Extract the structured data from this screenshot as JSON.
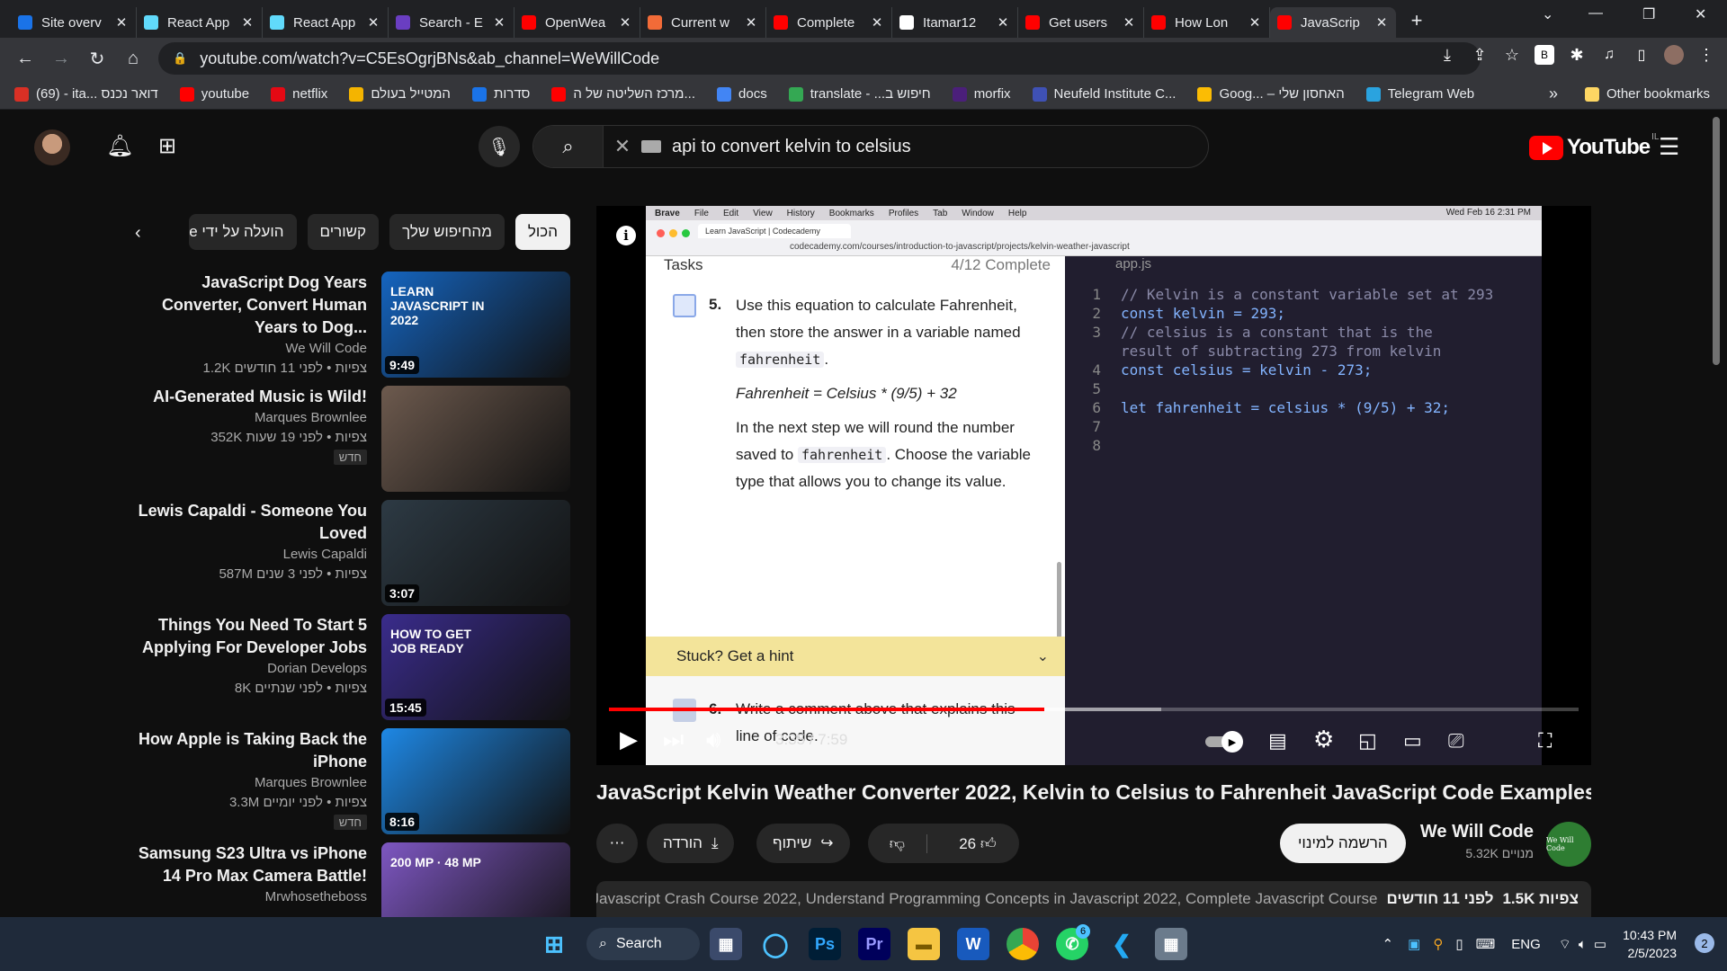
{
  "browser": {
    "tabs": [
      {
        "label": "Site overv",
        "color": "#1a73e8",
        "icon": "site-icon"
      },
      {
        "label": "React App",
        "color": "#61dafb",
        "icon": "react-icon"
      },
      {
        "label": "React App",
        "color": "#61dafb",
        "icon": "react-icon"
      },
      {
        "label": "Search - E",
        "color": "#6a3ec2",
        "icon": "bootstrap-icon"
      },
      {
        "label": "OpenWea",
        "color": "#ff0000",
        "icon": "youtube-icon"
      },
      {
        "label": "Current w",
        "color": "#f26b38",
        "icon": "weather-icon"
      },
      {
        "label": "Complete",
        "color": "#ff0000",
        "icon": "youtube-icon"
      },
      {
        "label": "Itamar12",
        "color": "#ffffff",
        "icon": "github-icon"
      },
      {
        "label": "Get users",
        "color": "#ff0000",
        "icon": "youtube-icon"
      },
      {
        "label": "How Lon",
        "color": "#ff0000",
        "icon": "youtube-icon"
      },
      {
        "label": "JavaScrip",
        "color": "#ff0000",
        "icon": "youtube-icon"
      }
    ],
    "url": "youtube.com/watch?v=C5EsOgrjBNs&ab_channel=WeWillCode",
    "bookmarks": [
      {
        "label": "(69) - ita... דואר נכנס",
        "color": "#d93025"
      },
      {
        "label": "youtube",
        "color": "#ff0000"
      },
      {
        "label": "netflix",
        "color": "#e50914"
      },
      {
        "label": "המטייל בעולם",
        "color": "#f4b400"
      },
      {
        "label": "סדרות",
        "color": "#1a73e8"
      },
      {
        "label": "מרכז השליטה של ה...",
        "color": "#ff0000"
      },
      {
        "label": "docs",
        "color": "#4285f4"
      },
      {
        "label": "translate - ...חיפוש ב",
        "color": "#34a853"
      },
      {
        "label": "morfix",
        "color": "#4b1f7a"
      },
      {
        "label": "Neufeld Institute C...",
        "color": "#3f51b5"
      },
      {
        "label": "Goog... – האחסון שלי",
        "color": "#fbbc04"
      },
      {
        "label": "Telegram Web",
        "color": "#2aa3df"
      }
    ],
    "other_bookmarks": "Other bookmarks"
  },
  "youtube": {
    "search_query": "api to convert kelvin to celsius",
    "logo_text": "YouTube",
    "country_code": "IL",
    "chips": [
      "הכול",
      "מהחיפוש שלך",
      "קשורים",
      "הועלה על ידי We Will Code"
    ],
    "sidebar": [
      {
        "title": "JavaScript Dog Years Converter, Convert Human Years to Dog...",
        "channel": "We Will Code",
        "meta": "1.2K צפיות • לפני 11 חודשים",
        "duration": "9:49",
        "new": "",
        "thumb_bg": "#1565c0",
        "thumb_label": "LEARN JAVASCRIPT IN 2022"
      },
      {
        "title": "AI-Generated Music is Wild!",
        "channel": "Marques Brownlee",
        "meta": "352K צפיות • לפני 19 שעות",
        "duration": "",
        "new": "חדש",
        "thumb_bg": "#6d5a4e",
        "thumb_label": ""
      },
      {
        "title": "Lewis Capaldi - Someone You Loved",
        "channel": "Lewis Capaldi",
        "meta": "587M צפיות • לפני 3 שנים",
        "duration": "3:07",
        "new": "",
        "thumb_bg": "#2d3a44",
        "thumb_label": ""
      },
      {
        "title": "Things You Need To Start 5 Applying For Developer Jobs",
        "channel": "Dorian Develops",
        "meta": "8K צפיות • לפני שנתיים",
        "duration": "15:45",
        "new": "",
        "thumb_bg": "#3a2c8c",
        "thumb_label": "HOW TO GET JOB READY"
      },
      {
        "title": "How Apple is Taking Back the iPhone",
        "channel": "Marques Brownlee",
        "meta": "3.3M צפיות • לפני יומיים",
        "duration": "8:16",
        "new": "חדש",
        "thumb_bg": "#1e88e5",
        "thumb_label": ""
      },
      {
        "title": "Samsung S23 Ultra vs iPhone 14 Pro Max Camera Battle!",
        "channel": "Mrwhosetheboss",
        "meta": "",
        "duration": "",
        "new": "",
        "thumb_bg": "#7e57c2",
        "thumb_label": "200 MP · 48 MP"
      }
    ],
    "video": {
      "title": "JavaScript Kelvin Weather Converter 2022, Kelvin to Celsius to Fahrenheit JavaScript Code Examples",
      "time": "3:35 / 7:59",
      "progress": 0.449,
      "buffered": 0.57,
      "channel": "We Will Code",
      "subscribers": "5.32K מנויים",
      "subscribe_label": "הרשמה למינוי",
      "likes": "26",
      "share_label": "שיתוף",
      "download_label": "הורדה",
      "desc_views": "1.5K צפיות",
      "desc_date": "לפני 11 חודשים",
      "desc_text": "Javascript Crash Course 2022, Understand Programming Concepts in Javascript 2022, Complete Javascript Course",
      "avatar_text": "We Will Code"
    },
    "screen": {
      "mac_menu": [
        "Brave",
        "File",
        "Edit",
        "View",
        "History",
        "Bookmarks",
        "Profiles",
        "Tab",
        "Window",
        "Help"
      ],
      "mac_clock": "Wed Feb 16  2:31 PM",
      "inner_tab": "Learn JavaScript | Codecademy",
      "inner_url": "codecademy.com/courses/introduction-to-javascript/projects/kelvin-weather-javascript",
      "tasks_label": "Tasks",
      "tasks_progress": "4/12 Complete",
      "task5_num": "5.",
      "task5_text_a": "Use this equation to calculate Fahrenheit, then store the answer in a variable named",
      "task5_code": "fahrenheit",
      "task5_formula": "Fahrenheit = Celsius * (9/5) + 32",
      "task5_text_b": "In the next step we will round the number saved to",
      "task5_text_c": ". Choose the variable type that allows you to change its value.",
      "hint": "Stuck? Get a hint",
      "task6_num": "6.",
      "task6_text": "Write a comment above that explains this line of code.",
      "editor_tab": "app.js",
      "code": [
        {
          "n": "1",
          "t": "// Kelvin is a constant variable set at 293",
          "k": "comment"
        },
        {
          "n": "2",
          "t": "const kelvin = 293;",
          "k": "code"
        },
        {
          "n": "3",
          "t": "// celsius is a constant that is the",
          "k": "comment"
        },
        {
          "n": "",
          "t": "result of subtracting 273 from kelvin",
          "k": "comment"
        },
        {
          "n": "4",
          "t": "const celsius = kelvin - 273;",
          "k": "code"
        },
        {
          "n": "5",
          "t": "",
          "k": "code"
        },
        {
          "n": "6",
          "t": "let fahrenheit = celsius * (9/5) + 32;",
          "k": "code"
        },
        {
          "n": "7",
          "t": "",
          "k": "code"
        },
        {
          "n": "8",
          "t": "",
          "k": "code"
        }
      ]
    }
  },
  "taskbar": {
    "search_label": "Search",
    "apps": [
      "windows-start",
      "microsoft-store",
      "cortana",
      "photoshop",
      "premiere",
      "file-explorer",
      "word",
      "chrome",
      "whatsapp",
      "vscode",
      "calculator"
    ],
    "whatsapp_badge": "6",
    "language": "ENG",
    "time": "10:43 PM",
    "date": "2/5/2023",
    "notifications": "2"
  }
}
